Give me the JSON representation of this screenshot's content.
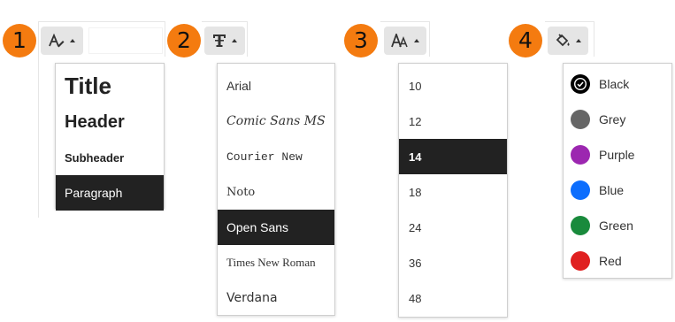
{
  "steps": [
    "1",
    "2",
    "3",
    "4"
  ],
  "menus": {
    "block_style": {
      "icon": "text-style-icon",
      "items": [
        {
          "label": "Title",
          "selected": false
        },
        {
          "label": "Header",
          "selected": false
        },
        {
          "label": "Subheader",
          "selected": false
        },
        {
          "label": "Paragraph",
          "selected": true
        }
      ]
    },
    "font_family": {
      "icon": "font-family-icon",
      "items": [
        {
          "label": "Arial",
          "selected": false
        },
        {
          "label": "Comic Sans MS",
          "selected": false
        },
        {
          "label": "Courier New",
          "selected": false
        },
        {
          "label": "Noto",
          "selected": false
        },
        {
          "label": "Open Sans",
          "selected": true
        },
        {
          "label": "Times New Roman",
          "selected": false
        },
        {
          "label": "Verdana",
          "selected": false
        }
      ]
    },
    "font_size": {
      "icon": "font-size-icon",
      "items": [
        {
          "label": "10",
          "selected": false
        },
        {
          "label": "12",
          "selected": false
        },
        {
          "label": "14",
          "selected": true
        },
        {
          "label": "18",
          "selected": false
        },
        {
          "label": "24",
          "selected": false
        },
        {
          "label": "36",
          "selected": false
        },
        {
          "label": "48",
          "selected": false
        }
      ]
    },
    "text_color": {
      "icon": "paint-bucket-icon",
      "items": [
        {
          "label": "Black",
          "color": "#000000",
          "selected": true
        },
        {
          "label": "Grey",
          "color": "#666666",
          "selected": false
        },
        {
          "label": "Purple",
          "color": "#9c27b0",
          "selected": false
        },
        {
          "label": "Blue",
          "color": "#0d6efd",
          "selected": false
        },
        {
          "label": "Green",
          "color": "#198a3c",
          "selected": false
        },
        {
          "label": "Red",
          "color": "#e02020",
          "selected": false
        }
      ]
    }
  },
  "colors": {
    "badge": "#f47b10",
    "selected_bg": "#222222",
    "button_bg": "#e5e5e5"
  }
}
